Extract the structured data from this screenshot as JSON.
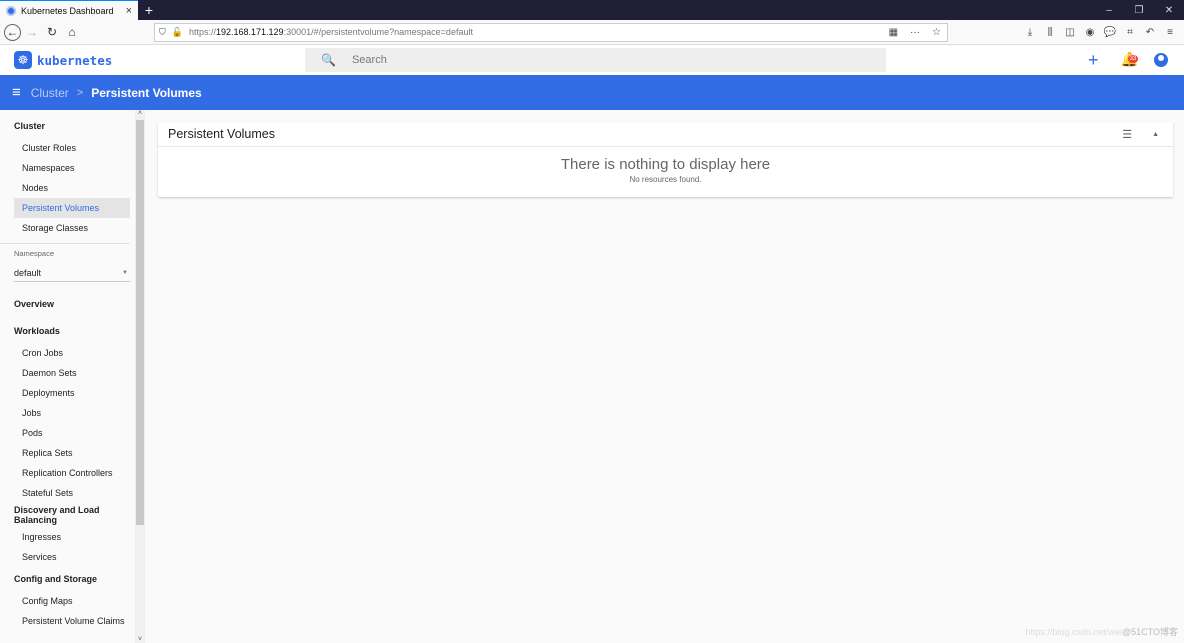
{
  "browser": {
    "tab_title": "Kubernetes Dashboard",
    "url_scheme": "https://",
    "url_host": "192.168.171.129",
    "url_rest": ":30001/#/persistentvolume?namespace=default",
    "icons": {
      "tab_close": "×",
      "new_tab": "+",
      "minimize": "–",
      "restore": "❐",
      "close": "✕",
      "back": "←",
      "forward": "→",
      "reload": "↻",
      "home": "⌂",
      "shield": "⛉",
      "lock": "🔓",
      "qr": "▦",
      "more": "···",
      "star": "☆",
      "download": "⤓",
      "library": "⫼",
      "sidebar": "◫",
      "account": "◉",
      "chat": "💬",
      "crop": "⌗",
      "undo": "↶",
      "menu": "≡"
    }
  },
  "app": {
    "logo_text": "kubernetes",
    "logo_icon": "☸",
    "search_placeholder": "Search",
    "search_icon": "🔍",
    "add_icon": "+",
    "bell_icon": "🔔",
    "notification_count": "33"
  },
  "toolbar": {
    "menu_icon": "≡",
    "breadcrumb_parent": "Cluster",
    "breadcrumb_sep": ">",
    "breadcrumb_current": "Persistent Volumes"
  },
  "sidebar": {
    "cluster": {
      "title": "Cluster",
      "items": [
        "Cluster Roles",
        "Namespaces",
        "Nodes",
        "Persistent Volumes",
        "Storage Classes"
      ]
    },
    "namespace": {
      "label": "Namespace",
      "value": "default",
      "arrow": "▼"
    },
    "overview": "Overview",
    "workloads": {
      "title": "Workloads",
      "items": [
        "Cron Jobs",
        "Daemon Sets",
        "Deployments",
        "Jobs",
        "Pods",
        "Replica Sets",
        "Replication Controllers",
        "Stateful Sets"
      ]
    },
    "discovery": {
      "title": "Discovery and Load Balancing",
      "items": [
        "Ingresses",
        "Services"
      ]
    },
    "config": {
      "title": "Config and Storage",
      "items": [
        "Config Maps",
        "Persistent Volume Claims"
      ]
    },
    "scroll_up": "˄",
    "scroll_down": "˅"
  },
  "card": {
    "title": "Persistent Volumes",
    "filter_icon": "☰",
    "collapse_icon": "▲",
    "empty_title": "There is nothing to display here",
    "empty_subtitle": "No resources found."
  },
  "watermark": {
    "faint": "https://blog.csdn.net/wei",
    "strong": "@51CTO博客"
  }
}
